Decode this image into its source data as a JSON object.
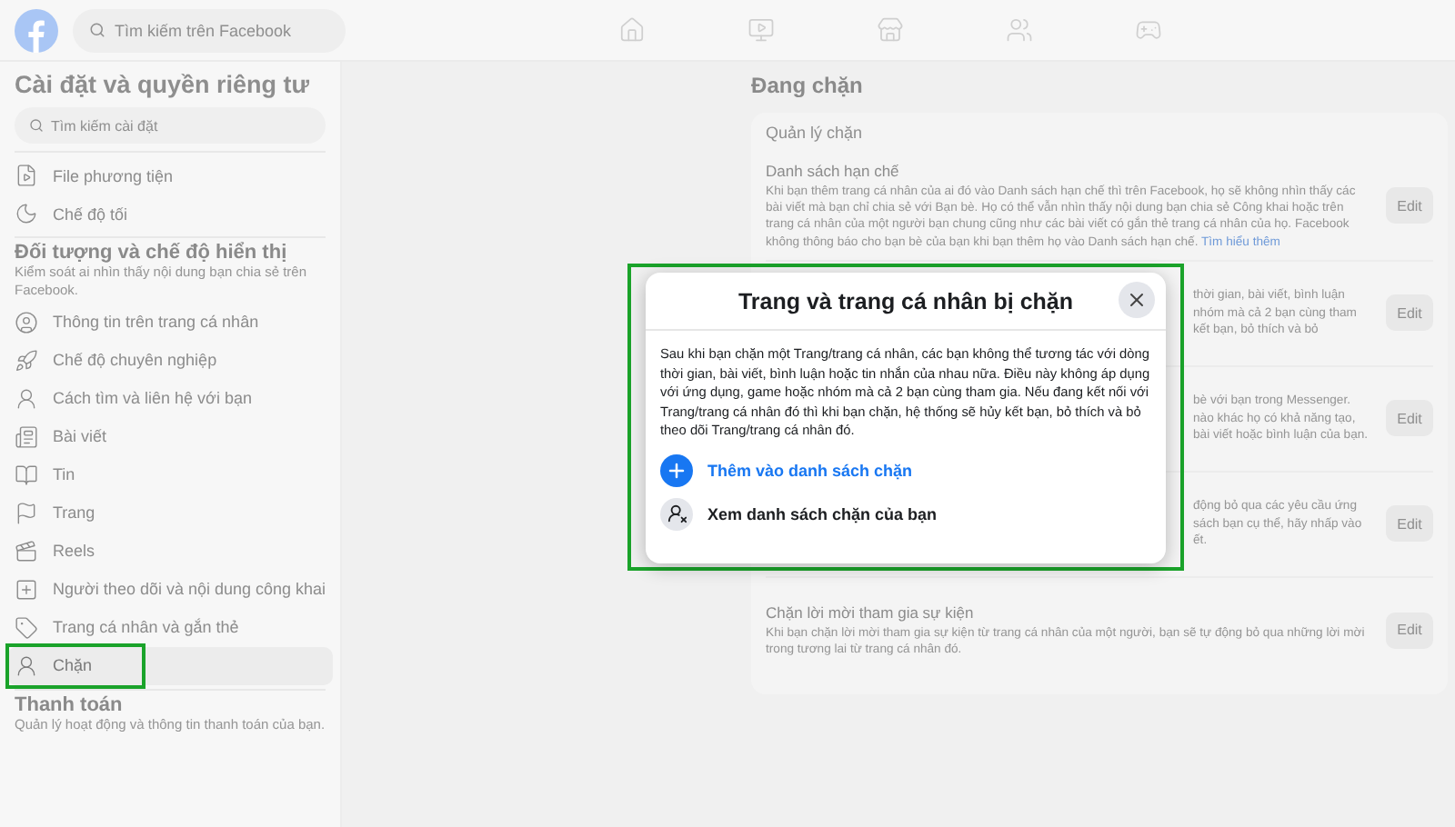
{
  "top_bar": {
    "search": {
      "placeholder": "Tìm kiếm trên Facebook"
    },
    "nav": [
      {
        "kind": "home"
      },
      {
        "kind": "video"
      },
      {
        "kind": "store"
      },
      {
        "kind": "groups"
      },
      {
        "kind": "gaming"
      }
    ]
  },
  "sidebar": {
    "title": "Cài đặt và quyền riêng tư",
    "search": {
      "placeholder": "Tìm kiếm cài đặt"
    },
    "top_items": [
      {
        "label": "File phương tiện",
        "selected": false
      },
      {
        "label": "Chế độ tối",
        "selected": false
      }
    ],
    "section": {
      "title": "Đối tượng và chế độ hiển thị",
      "description": "Kiểm soát ai nhìn thấy nội dung bạn chia sẻ trên Facebook."
    },
    "items": [
      {
        "label": "Thông tin trên trang cá nhân",
        "selected": false
      },
      {
        "label": "Chế độ chuyên nghiệp",
        "selected": false
      },
      {
        "label": "Cách tìm và liên hệ với bạn",
        "selected": false
      },
      {
        "label": "Bài viết",
        "selected": false
      },
      {
        "label": "Tin",
        "selected": false
      },
      {
        "label": "Trang",
        "selected": false
      },
      {
        "label": "Reels",
        "selected": false
      },
      {
        "label": "Người theo dõi và nội dung công khai",
        "selected": false
      },
      {
        "label": "Trang cá nhân và gắn thẻ",
        "selected": false
      },
      {
        "label": "Chặn",
        "selected": true
      }
    ],
    "section2": {
      "title": "Thanh toán",
      "description": "Quản lý hoạt động và thông tin thanh toán của bạn."
    }
  },
  "content": {
    "heading": "Đang chặn",
    "card_title": "Quản lý chặn",
    "rows": [
      {
        "title": "Danh sách hạn chế",
        "description": "Khi bạn thêm trang cá nhân của ai đó vào Danh sách hạn chế thì trên Facebook, họ sẽ không nhìn thấy các bài viết mà bạn chỉ chia sẻ với Bạn bè. Họ có thể vẫn nhìn thấy nội dung bạn chia sẻ Công khai hoặc trên trang cá nhân của một người bạn chung cũng như các bài viết có gắn thẻ trang cá nhân của họ. Facebook không thông báo cho bạn bè của bạn khi bạn thêm họ vào Danh sách hạn chế.",
        "link": "Tìm hiểu thêm",
        "button": "Edit"
      },
      {
        "lines": [
          "thời gian, bài viết, bình luận",
          "nhóm mà cả 2 bạn cùng tham",
          "kết bạn, bỏ thích và bỏ"
        ],
        "button": "Edit"
      },
      {
        "lines": [
          "bè với bạn trong Messenger.",
          "nào khác họ có khả năng tạo,",
          "bài viết hoặc bình luận của bạn."
        ],
        "button": "Edit"
      },
      {
        "lines": [
          "động bỏ qua các yêu cầu ứng",
          "sách bạn cụ thể, hãy nhấp vào",
          "ết."
        ],
        "button": "Edit"
      },
      {
        "title": "Chặn lời mời tham gia sự kiện",
        "description": "Khi bạn chặn lời mời tham gia sự kiện từ trang cá nhân của một người, bạn sẽ tự động bỏ qua những lời mời trong tương lai từ trang cá nhân đó.",
        "button": "Edit"
      }
    ]
  },
  "dialog": {
    "title": "Trang và trang cá nhân bị chặn",
    "body": "Sau khi bạn chặn một Trang/trang cá nhân, các bạn không thể tương tác với dòng thời gian, bài viết, bình luận hoặc tin nhắn của nhau nữa. Điều này không áp dụng với ứng dụng, game hoặc nhóm mà cả 2 bạn cùng tham gia. Nếu đang kết nối với Trang/trang cá nhân đó thì khi bạn chặn, hệ thống sẽ hủy kết bạn, bỏ thích và bỏ theo dõi Trang/trang cá nhân đó.",
    "actions": [
      {
        "label": "Thêm vào danh sách chặn",
        "kind": "add"
      },
      {
        "label": "Xem danh sách chặn của bạn",
        "kind": "view"
      }
    ]
  }
}
